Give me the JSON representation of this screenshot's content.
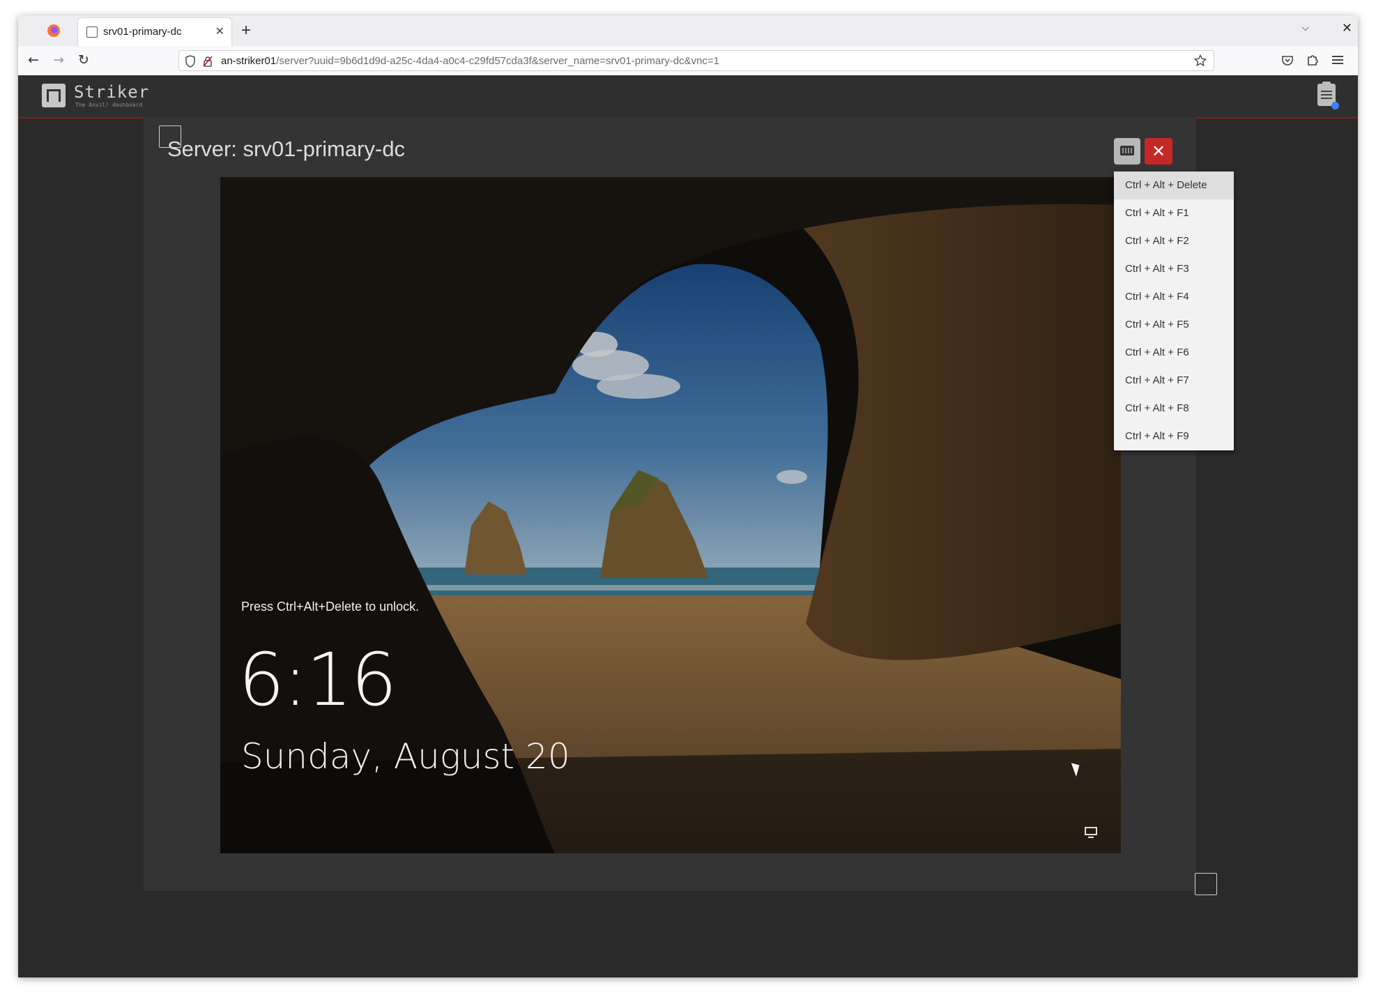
{
  "browser": {
    "tab_title": "srv01-primary-dc",
    "tab_close": "✕",
    "new_tab": "+",
    "list_tabs": "⌵",
    "window_close": "✕",
    "url_host": "an-striker01",
    "url_rest": "/server?uuid=9b6d1d9d-a25c-4da4-a0c4-c29fd57cda3f&server_name=srv01-primary-dc&vnc=1",
    "nav": {
      "back": "←",
      "forward": "→",
      "reload": "↻"
    }
  },
  "app": {
    "brand": "Striker",
    "tagline": "The Anvil! dashboard"
  },
  "server": {
    "title": "Server: srv01-primary-dc",
    "close_label": "✕"
  },
  "vnc": {
    "lock_message": "Press Ctrl+Alt+Delete to unlock.",
    "time": "6:16",
    "date": "Sunday, August 20"
  },
  "key_menu": {
    "items": [
      "Ctrl + Alt + Delete",
      "Ctrl + Alt + F1",
      "Ctrl + Alt + F2",
      "Ctrl + Alt + F3",
      "Ctrl + Alt + F4",
      "Ctrl + Alt + F5",
      "Ctrl + Alt + F6",
      "Ctrl + Alt + F7",
      "Ctrl + Alt + F8",
      "Ctrl + Alt + F9"
    ]
  },
  "colors": {
    "accent_red": "#c62828",
    "header_bg": "#2f2f2f",
    "header_border": "#8a1c1c",
    "status_dot": "#3b82f6"
  }
}
